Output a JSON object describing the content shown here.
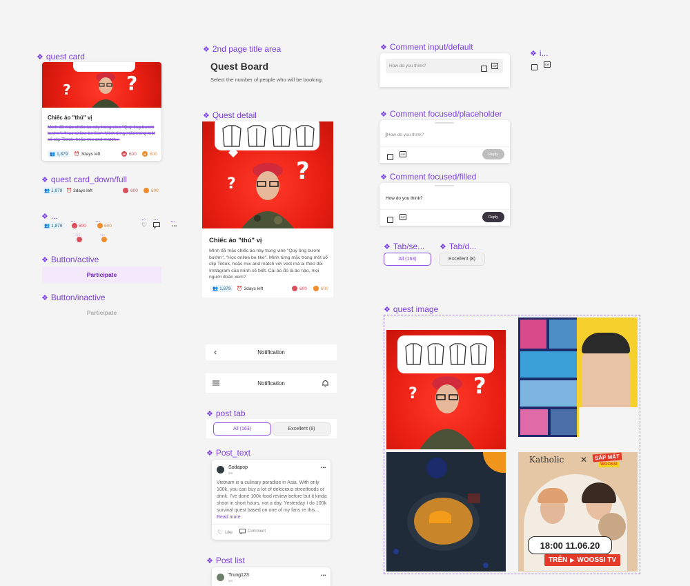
{
  "labels": {
    "quest_card": "quest card",
    "quest_card_down": "quest card_down/full",
    "dots1": "...",
    "button_active": "Button/active",
    "button_inactive": "Button/inactive",
    "second_page": "2nd page title area",
    "quest_detail": "Quest detail",
    "post_tab": "post tab",
    "post_text": "Post_text",
    "post_list": "Post list",
    "comment_default": "Comment input/default",
    "comment_focused_placeholder": "Comment focused/placeholder",
    "comment_focused_filled": "Comment focused/filled",
    "i_dots": "i...",
    "tab_se": "Tab/se...",
    "tab_d": "Tab/d...",
    "quest_image": "quest image"
  },
  "quest_card": {
    "title": "Chiếc áo \"thú\" vị",
    "desc": "Mình đã mặc chiếc áo này trong vine \"Quý ông bươm bướm\", \"Học online be like\". Minh từng mặc trong một số clip Tiktok, hoặc mix and match...",
    "count": "1,879",
    "days": "3days left",
    "sp": "600",
    "h": "600",
    "coin_sp": "SP",
    "coin_h": "H"
  },
  "quest_card_down": {
    "count": "1,879",
    "days": "3days left",
    "sp": "600",
    "h": "600"
  },
  "mini": {
    "count": "1,879",
    "sp": "600",
    "h": "600",
    "dots": "...",
    "more": "..."
  },
  "button": {
    "active": "Participate",
    "inactive": "Participate"
  },
  "page_title": {
    "title": "Quest Board",
    "subtitle": "Select the number of people who will be booking."
  },
  "quest_detail": {
    "title": "Chiếc áo \"thú\" vị",
    "desc": "Mình đã mặc chiếc áo này trong vine \"Quý ông bươm bướm\", \"Học online be like\". Minh từng mặc trong một số clip Tiktok, hoặc mix and match với vest mà ai theo dõi Instagram của mình sẽ biết.  Cái áo đó là áo nào, mọi người đoán xem?",
    "count": "1,879",
    "days": "3days left",
    "sp": "600",
    "h": "600"
  },
  "notification": {
    "title1": "Notification",
    "title2": "Notification"
  },
  "post_tab": {
    "all": "All (163)",
    "excellent": "Excellent (8)"
  },
  "post_text": {
    "user": "Sodapop",
    "time": "2m",
    "body": "Vietnam is a culinary paradise in Asia. With only 100k, you can buy a lot of delecious streetfoods or drink. I've done 100k food review before but it kinda shoot in short hours, not a day. Yesterday I do 100k survival quest based on one of my fans re this...",
    "read_more": "Read more",
    "like": "Like",
    "comment": "Comment",
    "menu": "..."
  },
  "post_list": {
    "user": "Trung123",
    "time": "2m",
    "menu": "..."
  },
  "comment": {
    "placeholder": "How do you think?",
    "filled": "How do you think?",
    "reply": "Reply",
    "gif": "GIF"
  },
  "tabs": {
    "all": "All (163)",
    "excellent": "Excellent (8)"
  },
  "quest_image": {
    "katholic": "Katholic",
    "x": "✕",
    "sap_mat": "SẮP MẤT",
    "woossi": "WOOSSI",
    "time": "18:00 11.06.20",
    "tren": "TRÊN",
    "woossi_tv": "WOOSSI TV"
  }
}
